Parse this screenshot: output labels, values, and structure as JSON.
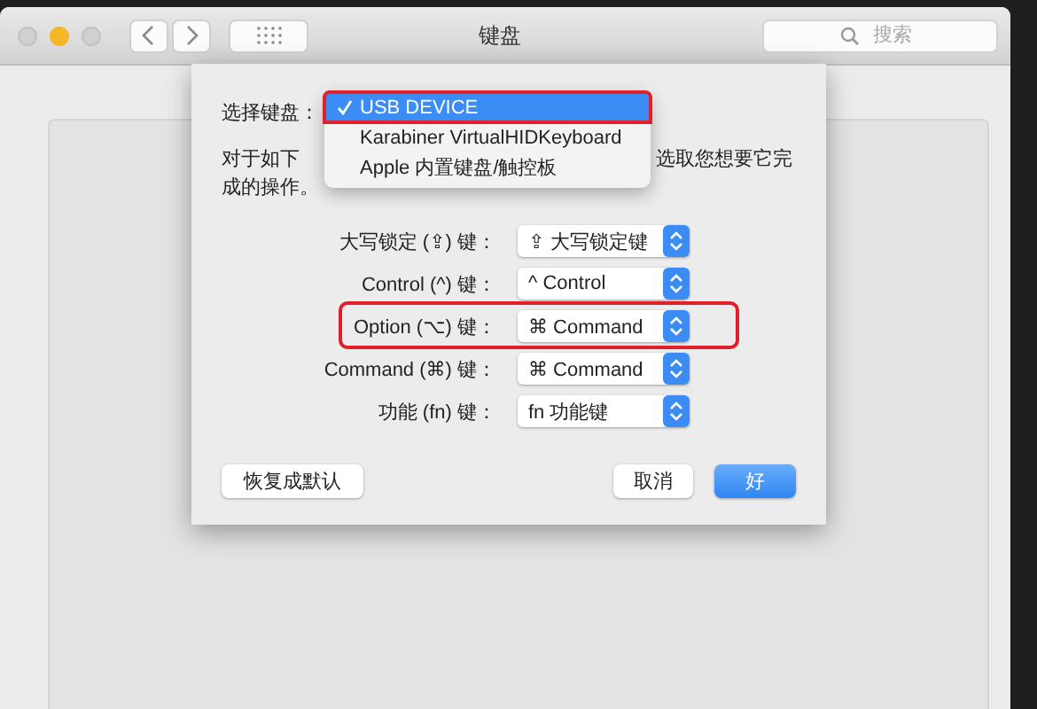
{
  "window": {
    "title": "键盘",
    "search": {
      "placeholder": "搜索"
    }
  },
  "sheet": {
    "keyboard_label": "选择键盘：",
    "keyboard_menu": [
      {
        "label": "USB DEVICE",
        "selected": true,
        "highlighted": true
      },
      {
        "label": "Karabiner VirtualHIDKeyboard",
        "selected": false,
        "highlighted": false
      },
      {
        "label": "Apple 内置键盘/触控板",
        "selected": false,
        "highlighted": false
      }
    ],
    "description": {
      "line1_start": "对于如下",
      "line1_end": "选取您想要它完",
      "line2": "成的操作。"
    },
    "modifier_rows": [
      {
        "label": "大写锁定 (⇪) 键：",
        "value": "⇪ 大写锁定键",
        "highlighted": false
      },
      {
        "label": "Control (^) 键：",
        "value": "^ Control",
        "highlighted": false
      },
      {
        "label": "Option (⌥) 键：",
        "value": "⌘ Command",
        "highlighted": true
      },
      {
        "label": "Command (⌘) 键：",
        "value": "⌘ Command",
        "highlighted": false
      },
      {
        "label": "功能 (fn) 键：",
        "value": "fn 功能键",
        "highlighted": false
      }
    ],
    "buttons": [
      {
        "label": "恢复成默认",
        "kind": "secondary"
      },
      {
        "label": "取消",
        "kind": "cancel"
      },
      {
        "label": "好",
        "kind": "default"
      }
    ]
  }
}
